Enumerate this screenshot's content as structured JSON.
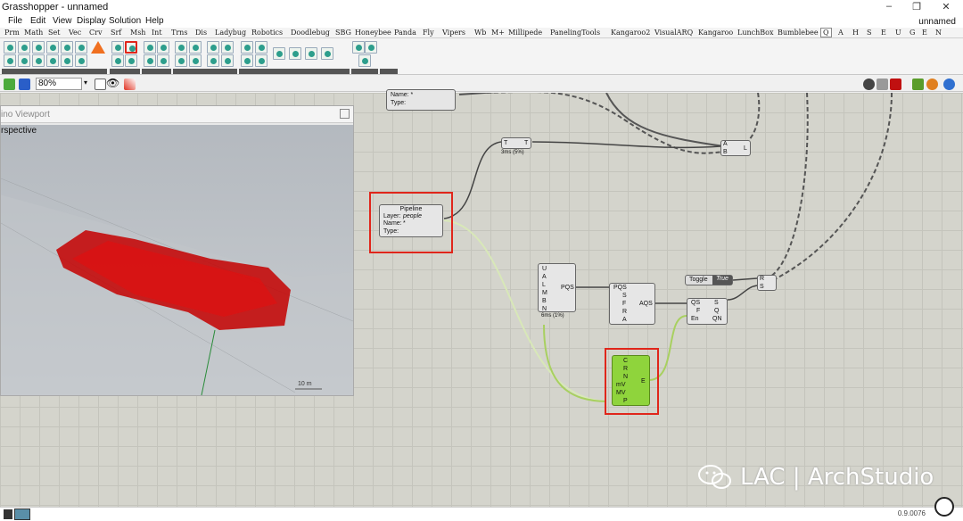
{
  "window": {
    "title": "Grasshopper - unnamed",
    "doc_name": "unnamed",
    "min": "–",
    "max": "❐",
    "close": "✕"
  },
  "menu": [
    "File",
    "Edit",
    "View",
    "Display",
    "Solution",
    "Help"
  ],
  "tabs": [
    "Prm",
    "Math",
    "Set",
    "Vec",
    "Crv",
    "Srf",
    "Msh",
    "Int",
    "Trns",
    "Dis",
    "Ladybug",
    "Robotics",
    "Doodlebug",
    "SBG",
    "Honeybee",
    "Panda",
    "Fly",
    "Vipers",
    "Wb",
    "M+",
    "Millipede",
    "PanelingTools",
    "Kangaroo2",
    "VisualARQ",
    "Kangaroo",
    "LunchBox",
    "Bumblebee",
    "Q",
    "A",
    "H",
    "S",
    "E",
    "U",
    "G",
    "E",
    "N"
  ],
  "toolbar": {
    "zoom": "80%"
  },
  "viewport": {
    "title": "ino Viewport",
    "label": "rspective",
    "scale": "10 m"
  },
  "components": {
    "top_partial": {
      "name_label": "Name: *",
      "type_label": "Type:"
    },
    "pipeline": {
      "title": "Pipeline",
      "layer_label": "Layer:",
      "layer_value": "people",
      "name_label": "Name:",
      "name_value": "*",
      "type_label": "Type:"
    },
    "boolean": {
      "in": "T",
      "out": "T",
      "footer": "3ms (5%)"
    },
    "ab": {
      "a": "A",
      "b": "B",
      "out": "L"
    },
    "pqs": {
      "inputs": [
        "U",
        "A",
        "L",
        "M",
        "B",
        "N"
      ],
      "out": "PQS",
      "footer": "6ms (1%)"
    },
    "aqs": {
      "inputs": [
        "PQS",
        "S",
        "F",
        "R",
        "A"
      ],
      "out": "AQS"
    },
    "qs": {
      "inputs": [
        "QS",
        "F",
        "En"
      ],
      "outputs": [
        "S",
        "Q",
        "QN"
      ]
    },
    "toggle": {
      "label": "Toggle",
      "value": "True"
    },
    "solver": {
      "inputs": [
        "R",
        "S"
      ]
    },
    "green": {
      "inputs": [
        "C",
        "R",
        "N",
        "mV",
        "MV",
        "P"
      ],
      "out": "E"
    }
  },
  "status": {
    "version": "0.9.0076"
  },
  "watermark": {
    "text": "LAC | ArchStudio"
  },
  "colors": {
    "highlight": "#e0261b",
    "green_comp": "#8fd43c",
    "canvas": "#d4d4cc",
    "mesh": "#c40000"
  }
}
